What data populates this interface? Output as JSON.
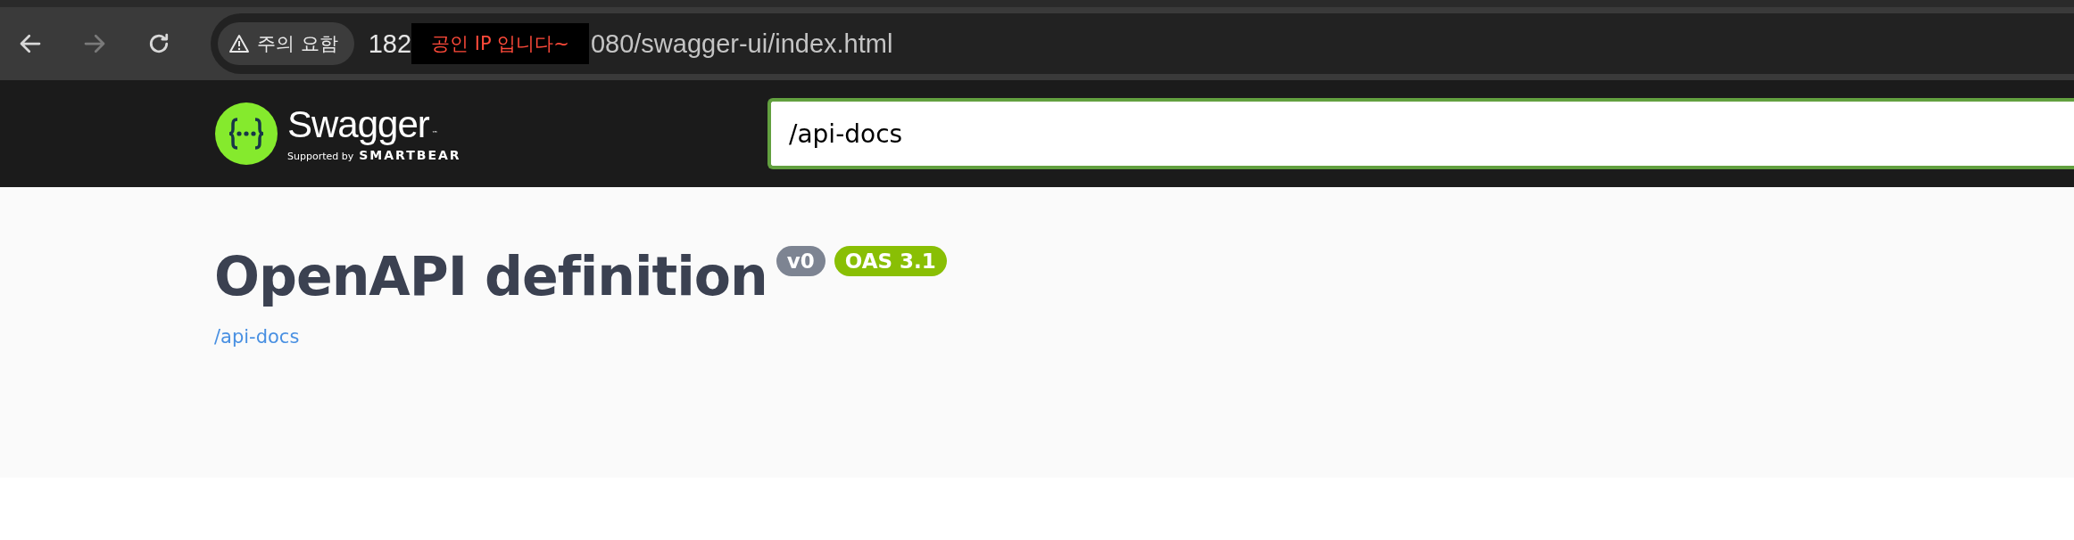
{
  "browser": {
    "nav_buttons": [
      {
        "kind": "back",
        "disabled": false
      },
      {
        "kind": "forward",
        "disabled": true
      },
      {
        "kind": "reload",
        "disabled": false
      }
    ],
    "security_chip": "주의 요함",
    "url_start": "182",
    "redaction_note": "공인 IP 입니다~",
    "url_end": "080/swagger-ui/index.html"
  },
  "header": {
    "logo_name": "Swagger",
    "logo_mark": "™",
    "logo_tagline": "Supported by",
    "logo_brand": "SMARTBEAR",
    "search": {
      "value": "/api-docs"
    }
  },
  "info": {
    "title": "OpenAPI definition",
    "badges": [
      {
        "label": "v0",
        "color": "#7d8492"
      },
      {
        "label": "OAS 3.1",
        "color": "#89bf04"
      }
    ],
    "link": "/api-docs"
  }
}
